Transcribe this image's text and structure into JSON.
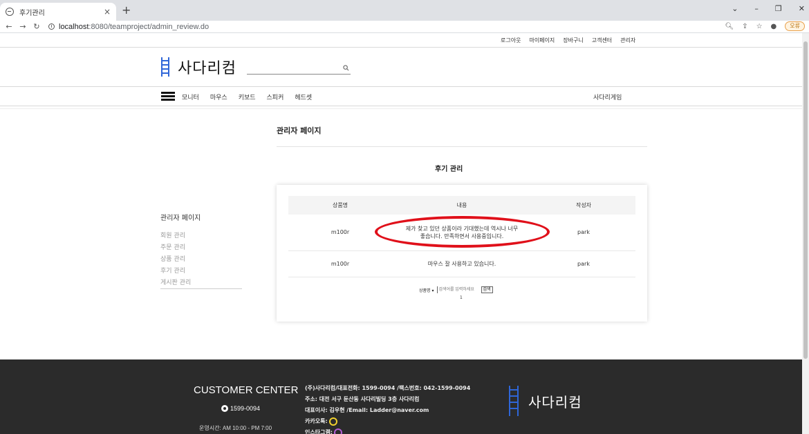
{
  "browser": {
    "tab_title": "후기관리",
    "tab_close": "×",
    "new_tab": "+",
    "url_host": "localhost",
    "url_path": ":8080/teamproject/admin_review.do",
    "profile_label": "오류"
  },
  "header": {
    "top_links": [
      "로그아웃",
      "마이페이지",
      "장바구니",
      "고객센터",
      "관리자"
    ],
    "logo_text": "사다리컴",
    "search_placeholder": ""
  },
  "category_nav": {
    "items": [
      "모니터",
      "마우스",
      "키보드",
      "스피커",
      "헤드셋"
    ],
    "brand_link": "사다리게임"
  },
  "admin": {
    "page_title": "관리자 페이지",
    "section_title": "후기 관리",
    "sidebar": {
      "title": "관리자 페이지",
      "items": [
        "회원 관리",
        "주문 관리",
        "상품 관리",
        "후기 관리",
        "게시판 관리"
      ]
    }
  },
  "reviews": {
    "columns": [
      "상품명",
      "내용",
      "작성자"
    ],
    "rows": [
      {
        "product": "m100r",
        "content_line1": "제가 찾고 있던 상품이라 기대했는데 역시나 너무",
        "content_line2": "좋습니다. 만족하면서 사용중입니다.",
        "author": "park"
      },
      {
        "product": "m100r",
        "content_line1": "마우스 잘 사용하고 있습니다.",
        "content_line2": "",
        "author": "park"
      }
    ],
    "search_select": "상품명",
    "search_placeholder": "검색어를 입력하세요",
    "search_button": "검색",
    "page": "1"
  },
  "footer": {
    "cc_title": "CUSTOMER CENTER",
    "cc_phone": "1599-0094",
    "cc_hours": "운영시간: AM 10:00 - PM 7:00",
    "info_lines": [
      "(주)사다리컴/대표전화: 1599-0094 /팩스번호: 042-1599-0094",
      "주소: 대전 서구 둔산동 사다리빌딩 3층 사다리컴",
      "대표이사: 김우현 /Email: Ladder@naver.com"
    ],
    "kakao_label": "카카오톡:",
    "insta_label": "인스타그램:",
    "logo_text": "사다리컴"
  },
  "colors": {
    "brand_blue": "#2f66d8",
    "highlight_red": "#e0101a",
    "footer_bg": "#2b2b2b"
  }
}
